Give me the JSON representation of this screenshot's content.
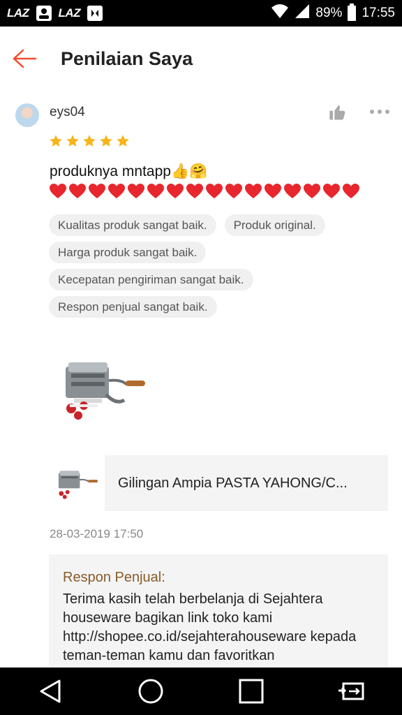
{
  "status_bar": {
    "app1": "LAZ",
    "app2": "LAZ",
    "battery": "89%",
    "time": "17:55"
  },
  "header": {
    "title": "Penilaian Saya",
    "back_icon": "arrow-left-icon"
  },
  "review": {
    "username": "eys04",
    "rating": 5,
    "text": "produknya mntapp👍🤗",
    "hearts_count": 16,
    "tags": [
      "Kualitas produk sangat baik.",
      "Produk original.",
      "Harga produk sangat baik.",
      "Kecepatan pengiriman sangat baik.",
      "Respon penjual sangat baik."
    ],
    "timestamp": "28-03-2019 17:50"
  },
  "product": {
    "name": "Gilingan Ampia PASTA YAHONG/C..."
  },
  "seller_response": {
    "label": "Respon Penjual:",
    "text": "Terima kasih telah berbelanja di Sejahtera houseware bagikan link toko kami http://shopee.co.id/sejahterahouseware kepada teman-teman kamu dan favoritkan"
  },
  "colors": {
    "accent": "#ee4d2d",
    "star": "#f8b41b",
    "heart": "#e8262d",
    "seller_label": "#8a5a2b"
  }
}
